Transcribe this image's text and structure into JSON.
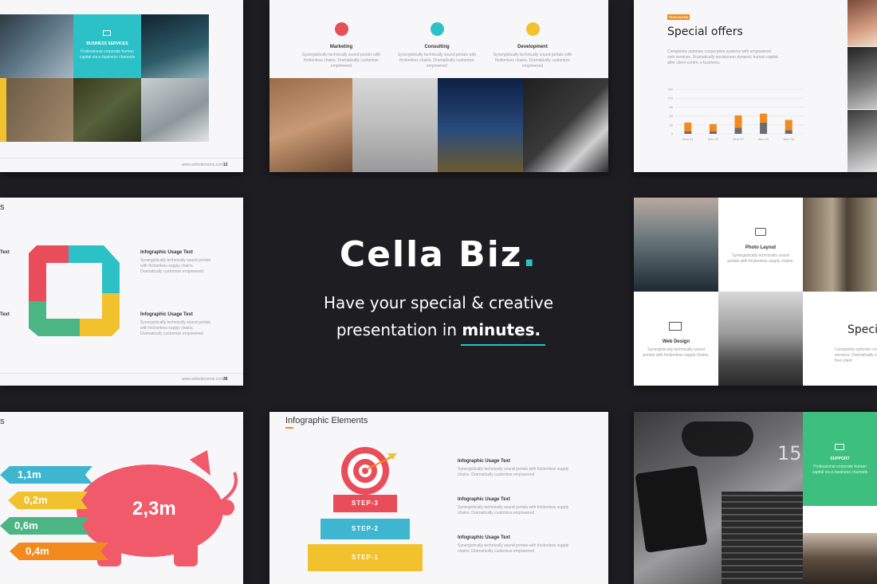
{
  "hero": {
    "title": "Cella Biz",
    "title_dot": ".",
    "subtitle_line1": "Have your special & creative",
    "subtitle_line2_pre": "presentation in ",
    "subtitle_line2_bold": "minutes."
  },
  "slide1": {
    "box_title": "BUSINESS SERVICES",
    "box_text": "Professional corporate human capital via e-business channels",
    "footer_url": "www.websitename.com",
    "page_num": "12"
  },
  "slide2": {
    "items": [
      {
        "title": "Marketing",
        "text": "Synergistically technically sound portals with frictionless chains. Dramatically customize empowered"
      },
      {
        "title": "Consulting",
        "text": "Synergistically technically sound portals with frictionless chains. Dramatically customize empowered"
      },
      {
        "title": "Development",
        "text": "Synergistically technically sound portals with frictionless chains. Dramatically customize empowered"
      }
    ]
  },
  "slide3": {
    "tag": "TEAM WORK",
    "title": "Special offers",
    "text": "Completely optimize cooperative systems with empowered web services. Dramatically envisioneer dynamic human capital after client-centric e-business.",
    "chart_data": {
      "type": "bar",
      "categories": [
        "Item 01",
        "Item 02",
        "Item 03",
        "Item 04",
        "Item 05"
      ],
      "series": [
        {
          "values": [
            8,
            8,
            20,
            38,
            12
          ]
        },
        {
          "values": [
            30,
            25,
            42,
            30,
            35
          ]
        }
      ],
      "ylim": [
        0,
        150
      ],
      "yticks": [
        "0",
        "30",
        "60",
        "90",
        "120",
        "150"
      ],
      "colors": [
        "#6b6b72",
        "#f28a1e"
      ]
    }
  },
  "slide4": {
    "head": "s",
    "items": [
      {
        "title": "Infographic Usage Text",
        "text": "Synergistically technically sound portals with frictionless supply chains. Dramatically customize empowered"
      },
      {
        "title": "Infographic Usage Text",
        "text": "Synergistically technically sound portals with frictionless supply chains. Dramatically customize empowered"
      }
    ],
    "left_labels": [
      "Text",
      "Text"
    ],
    "footer_url": "www.websitename.com",
    "page_num": "36"
  },
  "slide5": {
    "items": [
      {
        "title": "Photo Layout",
        "text": "Synergistically technically sound portals with frictionless supply chains."
      },
      {
        "title": "Web Design",
        "text": "Synergistically technically sound portals with frictionless supply chains."
      }
    ],
    "side_title": "Speci",
    "side_text": "Completely optimize coop services. Dramatically env free client"
  },
  "slide6": {
    "head": "s",
    "piggy_value": "2,3m",
    "arrows": [
      {
        "label": "1,1m",
        "color": "#3fb6d0"
      },
      {
        "label": "0,2m",
        "color": "#f2c12e"
      },
      {
        "label": "0,6m",
        "color": "#4cb584"
      },
      {
        "label": "0,4m",
        "color": "#f28a1e"
      }
    ]
  },
  "slide7": {
    "title": "Infographic Elements",
    "steps": [
      "STEP-3",
      "STEP-2",
      "STEP-1"
    ],
    "items": [
      {
        "title": "Infographic Usage Text",
        "text": "Synergistically technically sound portals with frictionless supply chains. Dramatically customize empowered"
      },
      {
        "title": "Infographic Usage Text",
        "text": "Synergistically technically sound portals with frictionless supply chains. Dramatically customize empowered"
      },
      {
        "title": "Infographic Usage Text",
        "text": "Synergistically technically sound portals with frictionless supply chains. Dramatically customize empowered"
      }
    ]
  },
  "slide8": {
    "box_title": "SUPPORT",
    "box_text": "Professional corporate human capital via e-business channels",
    "clock_text": "15"
  },
  "colors": {
    "background": "#1d1d22",
    "accent_teal": "#2bc1c7",
    "accent_green": "#3dbf7d",
    "accent_orange": "#f28a1e"
  }
}
